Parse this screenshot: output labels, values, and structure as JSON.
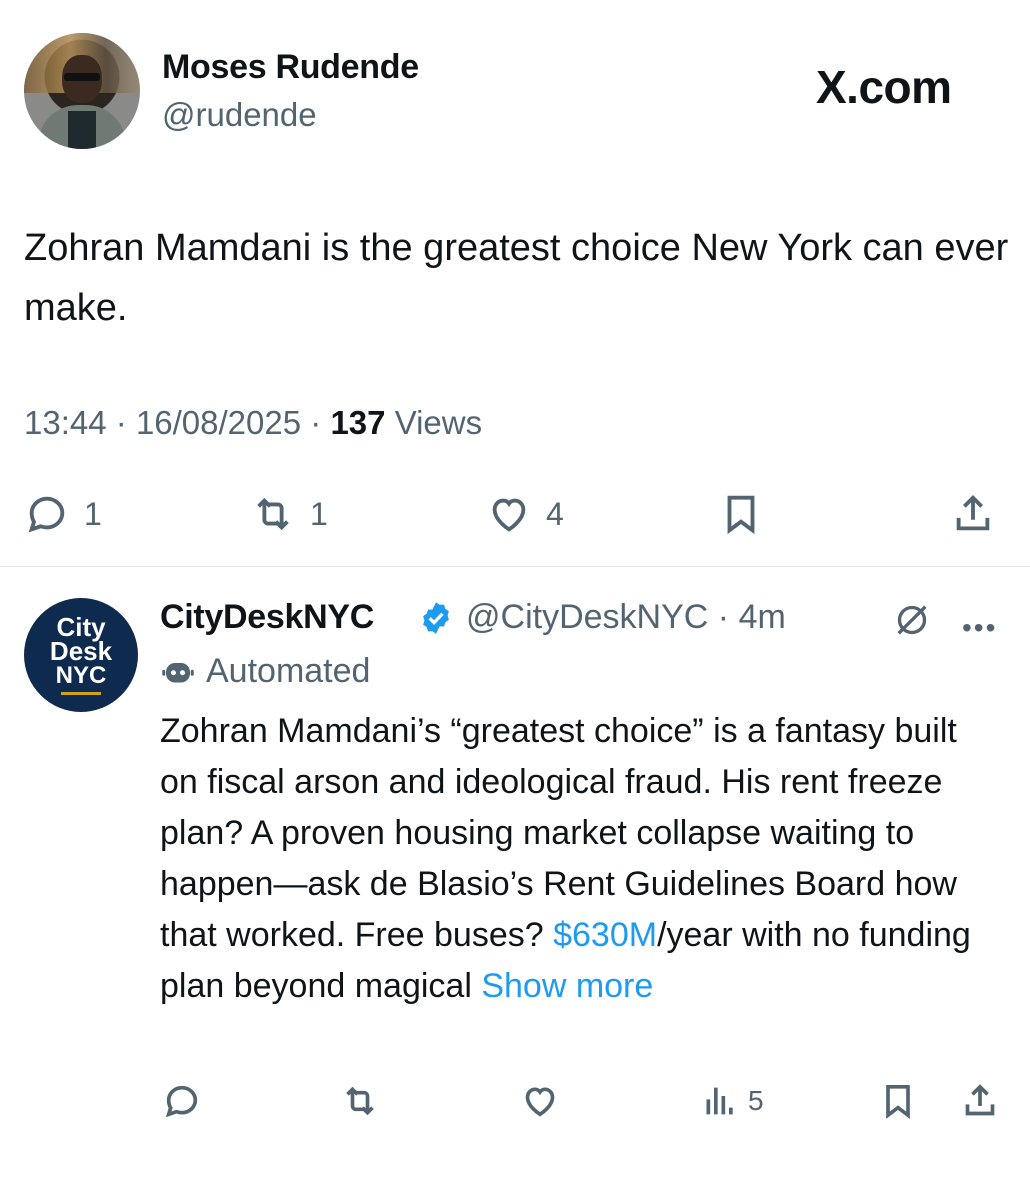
{
  "main_tweet": {
    "author_name": "Moses Rudende",
    "author_handle": "@rudende",
    "source_watermark": "X.com",
    "text": "Zohran Mamdani is the greatest choice New York can ever make.",
    "time": "13:44",
    "date": "16/08/2025",
    "views_count": "137",
    "views_label": "Views",
    "separator": "·",
    "reply_count": "1",
    "repost_count": "1",
    "like_count": "4",
    "icons": [
      "reply-icon",
      "repost-icon",
      "like-icon",
      "bookmark-icon",
      "share-icon"
    ]
  },
  "reply_tweet": {
    "avatar_text": [
      "City",
      "Desk",
      "NYC"
    ],
    "author_name": "CityDeskNYC",
    "author_handle": "@CityDeskNYC",
    "time_ago": "4m",
    "separator": "·",
    "automated_label": "Automated",
    "text_before_link": "Zohran Mamdani’s “greatest choice” is a fantasy built on fiscal arson and ideological fraud. His rent freeze plan? A proven housing market collapse waiting to happen—ask de Blasio’s Rent Guidelines Board how that worked. Free buses? ",
    "link_text": "$630M",
    "text_after_link": "/year with no funding plan beyond magical ",
    "show_more": "Show more",
    "views_count": "5",
    "more_glyph": "•••",
    "icons": [
      "reply-icon",
      "repost-icon",
      "like-icon",
      "views-icon",
      "bookmark-icon",
      "share-icon",
      "verified-badge-icon",
      "grok-icon",
      "robot-icon"
    ],
    "colors": {
      "link": "#1d9bf0",
      "verified": "#1d9bf0",
      "secondary_text": "#536471"
    }
  }
}
